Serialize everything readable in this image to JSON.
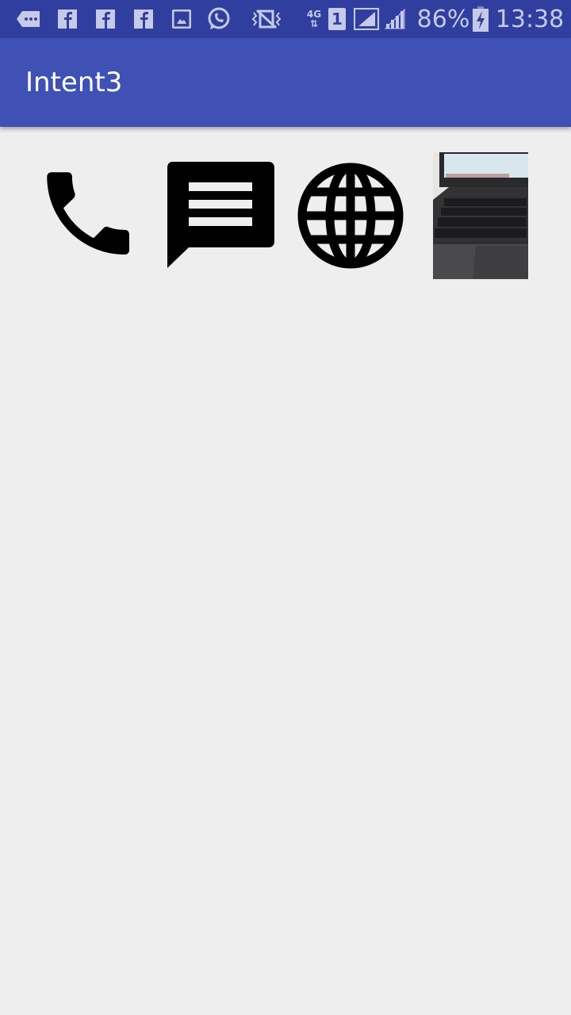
{
  "status_bar": {
    "icons": [
      "message-icon",
      "facebook-icon",
      "facebook-icon",
      "facebook-icon",
      "gallery-icon",
      "whatsapp-icon",
      "vibrate-mute-icon",
      "4g-data-icon",
      "sim1-icon",
      "signal-icon",
      "signal-icon",
      "battery-charging-icon"
    ],
    "network": "4G",
    "sim": "1",
    "battery": "86%",
    "time": "13:38"
  },
  "app_bar": {
    "title": "Intent3",
    "color": "#3f51b5"
  },
  "buttons": [
    {
      "name": "phone",
      "icon": "phone-icon"
    },
    {
      "name": "message",
      "icon": "message-icon"
    },
    {
      "name": "web",
      "icon": "globe-icon"
    },
    {
      "name": "camera",
      "icon": "photo-thumbnail"
    }
  ]
}
